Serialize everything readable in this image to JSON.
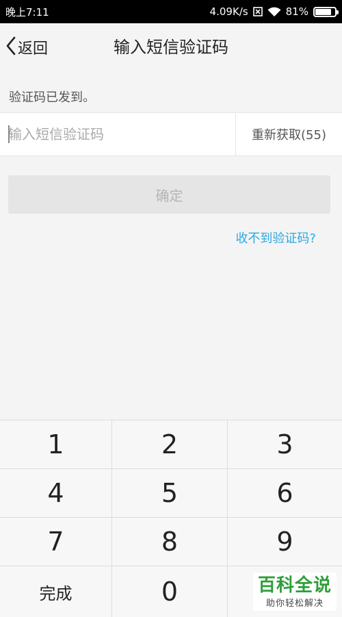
{
  "status_bar": {
    "time": "晚上7:11",
    "network_speed": "4.09K/s",
    "battery_percent": "81%",
    "battery_level": 0.81,
    "icons": [
      "sim-disabled-icon",
      "wifi-icon",
      "battery-icon"
    ]
  },
  "nav": {
    "back_label": "返回",
    "title": "输入短信验证码"
  },
  "hint": "验证码已发到。",
  "code_input": {
    "value": "",
    "placeholder": "输入短信验证码"
  },
  "resend_label": "重新获取(55)",
  "confirm_label": "确定",
  "help_link": "收不到验证码?",
  "keypad": {
    "keys": [
      "1",
      "2",
      "3",
      "4",
      "5",
      "6",
      "7",
      "8",
      "9",
      "完成",
      "0",
      ""
    ]
  },
  "watermark": {
    "title": "百科全说",
    "subtitle": "助你轻松解决"
  },
  "colors": {
    "link": "#2ea8e4",
    "button_disabled_bg": "#e5e5e5",
    "button_disabled_text": "#b5b5b5",
    "watermark_green": "#2e9e3a"
  }
}
